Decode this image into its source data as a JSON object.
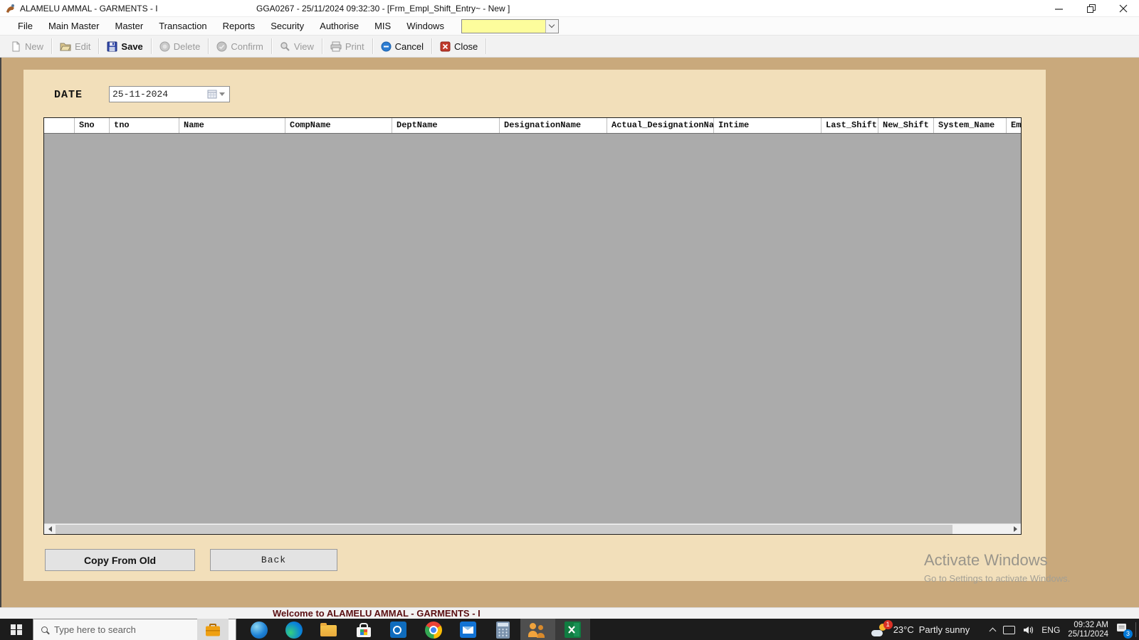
{
  "window": {
    "title": "ALAMELU AMMAL - GARMENTS - I",
    "session": "GGA0267 - 25/11/2024 09:32:30 - [Frm_Empl_Shift_Entry~ - New ]"
  },
  "menubar": {
    "items": [
      "File",
      "Main Master",
      "Master",
      "Transaction",
      "Reports",
      "Security",
      "Authorise",
      "MIS",
      "Windows"
    ],
    "quick_combo_value": ""
  },
  "toolbar": {
    "buttons": [
      {
        "label": "New",
        "enabled": false,
        "icon": "new-document-icon"
      },
      {
        "label": "Edit",
        "enabled": false,
        "icon": "open-folder-icon"
      },
      {
        "label": "Save",
        "enabled": true,
        "icon": "floppy-disk-icon"
      },
      {
        "label": "Delete",
        "enabled": false,
        "icon": "delete-circle-icon"
      },
      {
        "label": "Confirm",
        "enabled": false,
        "icon": "confirm-circle-icon"
      },
      {
        "label": "View",
        "enabled": false,
        "icon": "magnifier-icon"
      },
      {
        "label": "Print",
        "enabled": false,
        "icon": "printer-icon"
      },
      {
        "label": "Cancel",
        "enabled": true,
        "icon": "cancel-circle-icon"
      },
      {
        "label": "Close",
        "enabled": true,
        "icon": "close-red-icon"
      }
    ]
  },
  "form": {
    "date_label": "DATE",
    "date_value": "25-11-2024",
    "grid_columns": [
      "",
      "Sno",
      "tno",
      "Name",
      "CompName",
      "DeptName",
      "DesignationName",
      "Actual_DesignationNa",
      "Intime",
      "Last_Shift",
      "New_Shift",
      "System_Name",
      "Em"
    ],
    "grid_rows": [],
    "copy_from_old_label": "Copy From Old",
    "back_label": "Back"
  },
  "watermark": {
    "line1": "Activate Windows",
    "line2": "Go to Settings to activate Windows."
  },
  "statusbar": {
    "welcome_text": "Welcome to ALAMELU AMMAL - GARMENTS - I"
  },
  "taskbar": {
    "search_placeholder": "Type here to search",
    "apps": [
      "briefcase",
      "internet-explorer",
      "edge",
      "file-explorer",
      "store",
      "outlook",
      "chrome",
      "mail",
      "calculator",
      "people",
      "excel"
    ],
    "tray": {
      "weather_badge": "1",
      "temperature": "23°C",
      "condition": "Partly sunny",
      "language": "ENG",
      "time": "09:32 AM",
      "date": "25/11/2024",
      "notification_count": "3"
    }
  },
  "colors": {
    "form_background": "#f2dfba",
    "workspace_background": "#c9a97c",
    "grid_body": "#ababab",
    "combo_yellow": "#fdfd9c",
    "status_text": "#5a0f12",
    "taskbar_background": "#1c1c1c"
  }
}
